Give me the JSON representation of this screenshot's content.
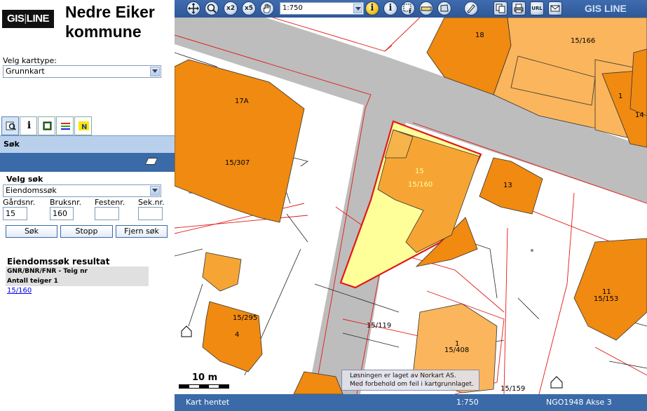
{
  "header": {
    "logo": {
      "left": "GIS",
      "sep": "|",
      "right": "LINE"
    },
    "kommune": "Nedre Eiker kommune"
  },
  "left_panel": {
    "karttype_label": "Velg karttype:",
    "karttype_value": "Grunnkart",
    "tabs": [
      "search-tab",
      "info-tab",
      "print-tab",
      "layers-tab",
      "north-tab"
    ],
    "search_header": "Søk",
    "velg_sok_label": "Velg søk",
    "sok_type_value": "Eiendomssøk",
    "fields": [
      {
        "label": "Gårdsnr.",
        "value": "15"
      },
      {
        "label": "Bruksnr.",
        "value": "160"
      },
      {
        "label": "Festenr.",
        "value": ""
      },
      {
        "label": "Sek.nr.",
        "value": ""
      }
    ],
    "buttons": {
      "sok": "Søk",
      "stopp": "Stopp",
      "fjern": "Fjern søk"
    },
    "results": {
      "title": "Eiendomssøk resultat",
      "header_row": "GNR/BNR/FNR - Teig nr",
      "count_row": "Antall teiger 1",
      "link": "15/160"
    }
  },
  "toolbar": {
    "scale": "1:750",
    "brand": "GIS LINE",
    "zoom_x2": "x2",
    "zoom_x5": "x5",
    "url": "URL"
  },
  "map": {
    "labels": [
      "18",
      "15/166",
      "17A",
      "1",
      "14",
      "15/307",
      "15",
      "15/160",
      "13",
      "11",
      "15/153",
      "15/295",
      "4",
      "15/119",
      "1",
      "15/408",
      "15/159"
    ],
    "scalebar": "10 m",
    "copyright_line1": "Løsningen er laget av Norkart AS.",
    "copyright_line2": "Med forbehold om feil i kartgrunnlaget."
  },
  "status": {
    "left": "Kart hentet",
    "scale": "1:750",
    "projection": "NGO1948 Akse 3"
  },
  "colors": {
    "accent": "#3a6aa8",
    "building": "#f08a10",
    "selected_parcel": "#ffff99",
    "road": "#bdbdbd"
  }
}
